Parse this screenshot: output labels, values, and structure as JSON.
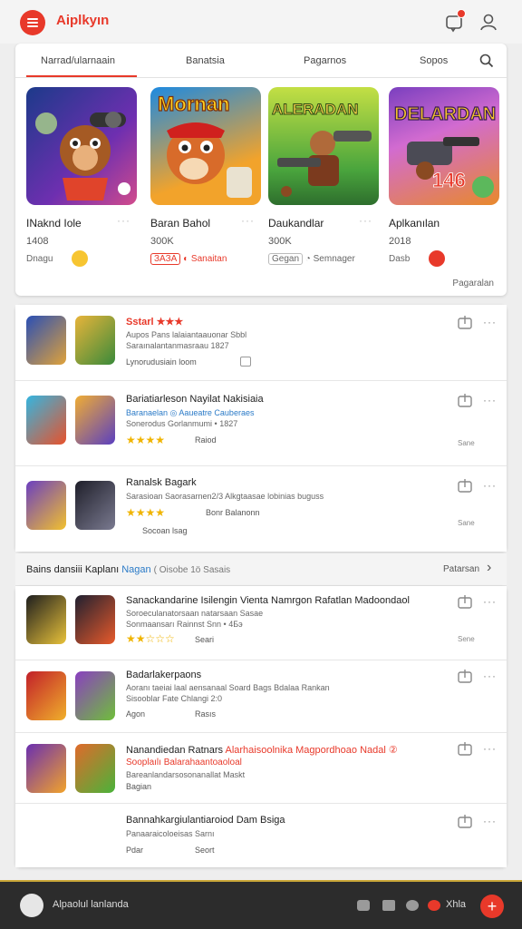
{
  "header": {
    "app_title": "Aiplkyın",
    "icons": [
      "menu-icon",
      "notification-icon",
      "user-icon"
    ]
  },
  "tabs": [
    {
      "label": "Narrad/ularnaain"
    },
    {
      "label": "Banatsia"
    },
    {
      "label": "Pagarnos"
    },
    {
      "label": "Sopos"
    }
  ],
  "featured": [
    {
      "name": "INaknd Iole",
      "count": "1408",
      "tag": "Dnagu",
      "art_text": ""
    },
    {
      "name": "Baran Bahol",
      "count": "300K",
      "tag": "Sanaitan",
      "pill": "ЗАЗА",
      "art_text": "Mornan"
    },
    {
      "name": "Daukandlar",
      "count": "300K",
      "tag": "Semnager",
      "pill": "Gegan",
      "art_text": "ALERADAN"
    },
    {
      "name": "Aplkanılan",
      "count": "2018",
      "tag": "Dasb",
      "art_text": "DELARDAN",
      "art_number": "146"
    }
  ],
  "featured_footer": "Pagaralan",
  "list_a": [
    {
      "title": "Sstarl ★★★",
      "line1": "Aupos Pans lalaiantaauonar Sbbl",
      "line2": "Saraınalantanmasraau 1827",
      "meta": "Lynorudusiain loom",
      "size": ""
    },
    {
      "title": "Bariatiarleson Nayilat Nakisiaia",
      "line1": "Baranaelan ◎ Aaueatre Cauberaes",
      "line2": "Sonerodus Gorlanmumi • 1827",
      "meta": "Raiod",
      "size": "Sane",
      "stars": "★★★★"
    },
    {
      "title": "Ranalsk Bagark",
      "line1": "Sarasioan Saorasarnen2/3 Alkgtaasae lobinias buguss",
      "line2": "",
      "meta": "Bonr Balanonn",
      "size": "Sane",
      "stars": "★★★★",
      "meta2": "Socoan lsag"
    }
  ],
  "section": {
    "title": "Bains dansiii Kaplanı",
    "highlight": "Nagan",
    "sub": "( Oisobe 1ö Sasais",
    "link": "Patarsan"
  },
  "list_b": [
    {
      "title": "Sanackandarine Isilengin Vienta Namrgon Rafatlan Madoondaol",
      "line1": "Soroeculanatorsaan natarsaan Sasae",
      "line2": "Sonmaansarı Rainnst Snn • 4Бэ",
      "meta": "Seari",
      "size": "Sene",
      "stars": "★★☆☆☆"
    },
    {
      "title": "Badarlakerpaons",
      "line1": "Aoranı taeiai laal aensanaal Soard Bags Bdalaa Rankan",
      "line2": "Sisooblar Fate Chlangi 2:0",
      "meta": "Rasıs",
      "meta_left": "Agon",
      "size": ""
    },
    {
      "title": "Nanandiedan Ratnars",
      "title_red": "Alarhaisoolnika Magpordhoao Nadal ②",
      "line1_red": "Sooplaılı Balarahaantoaoloal",
      "line2": "Bareanlandarsosonanallat Maskt",
      "meta": "Bagian",
      "size": ""
    },
    {
      "title": "Bannahkargiulantiaroiod Dam Bsiga",
      "line1": "Panaaraicoloeisas Sarnı",
      "line2": "",
      "meta": "Seort",
      "meta_left": "Pdar",
      "size": ""
    }
  ],
  "bottom": {
    "label": "Alpaolul lanlanda",
    "right_label": "Xhla",
    "fab": "+"
  }
}
